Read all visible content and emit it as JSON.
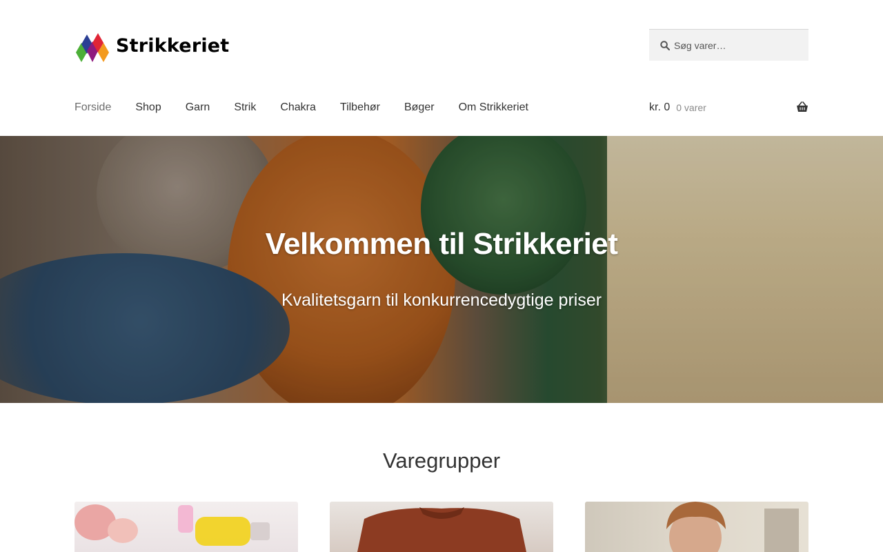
{
  "site": {
    "logo_text": "Strikkeriet",
    "logo_colors": [
      "#4caf37",
      "#8e1a7e",
      "#e02536",
      "#f39a1e",
      "#2b3f94"
    ]
  },
  "search": {
    "placeholder": "Søg varer…",
    "icon": "search-icon"
  },
  "nav": {
    "items": [
      {
        "label": "Forside",
        "active": true
      },
      {
        "label": "Shop"
      },
      {
        "label": "Garn"
      },
      {
        "label": "Strik"
      },
      {
        "label": "Chakra"
      },
      {
        "label": "Tilbehør"
      },
      {
        "label": "Bøger"
      },
      {
        "label": "Om Strikkeriet"
      }
    ]
  },
  "cart": {
    "amount": "kr. 0",
    "count": "0 varer",
    "icon": "basket-icon"
  },
  "hero": {
    "title": "Velkommen til Strikkeriet",
    "subtitle": "Kvalitetsgarn til konkurrencedygtige priser"
  },
  "section": {
    "title": "Varegrupper"
  },
  "colors": {
    "text": "#333333",
    "nav_active": "#6d6d6d",
    "search_bg": "#f2f2f2"
  }
}
